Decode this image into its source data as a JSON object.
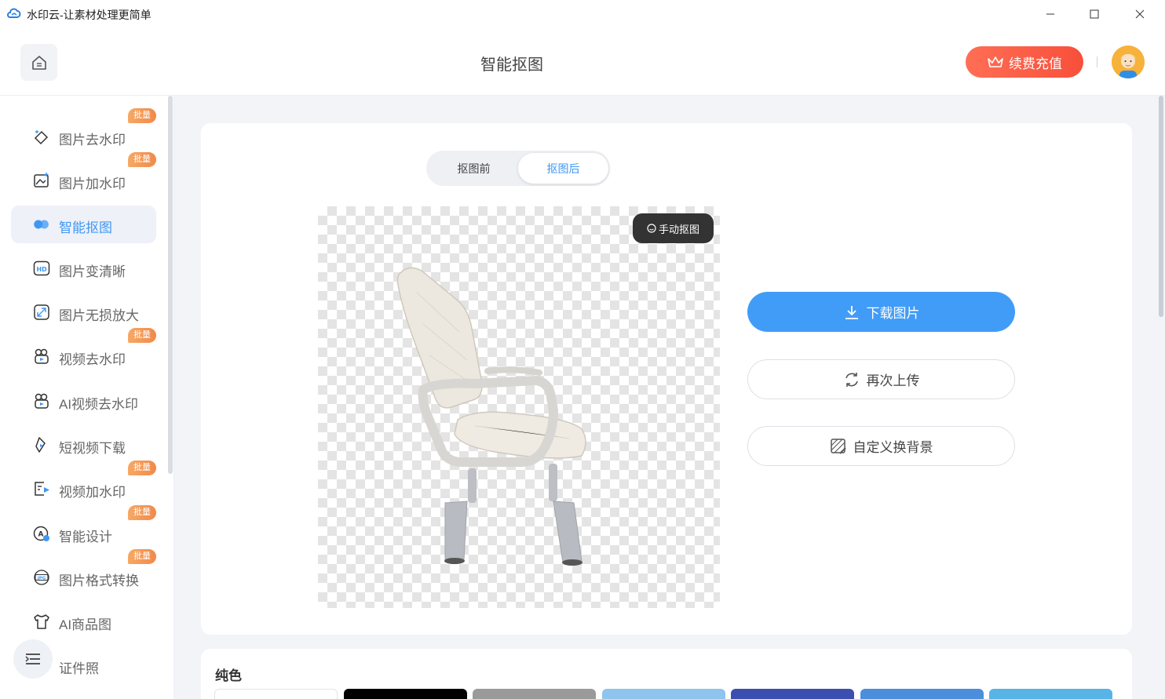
{
  "window": {
    "title": "水印云-让素材处理更简单"
  },
  "header": {
    "page_title": "智能抠图",
    "renew_label": "续费充值"
  },
  "sidebar": {
    "items": [
      {
        "label": "图片去水印",
        "badge": "批量",
        "icon": "image-remove-watermark-icon"
      },
      {
        "label": "图片加水印",
        "badge": "批量",
        "icon": "image-add-watermark-icon"
      },
      {
        "label": "智能抠图",
        "badge": "",
        "icon": "smart-cutout-icon",
        "active": true
      },
      {
        "label": "图片变清晰",
        "badge": "",
        "icon": "hd-icon"
      },
      {
        "label": "图片无损放大",
        "badge": "",
        "icon": "enlarge-icon"
      },
      {
        "label": "视频去水印",
        "badge": "批量",
        "icon": "video-remove-watermark-icon"
      },
      {
        "label": "AI视频去水印",
        "badge": "",
        "icon": "ai-video-remove-watermark-icon"
      },
      {
        "label": "短视频下载",
        "badge": "",
        "icon": "short-video-download-icon"
      },
      {
        "label": "视频加水印",
        "badge": "批量",
        "icon": "video-add-watermark-icon"
      },
      {
        "label": "智能设计",
        "badge": "批量",
        "icon": "smart-design-icon"
      },
      {
        "label": "图片格式转换",
        "badge": "批量",
        "icon": "jpg-convert-icon"
      },
      {
        "label": "AI商品图",
        "badge": "",
        "icon": "ai-product-image-icon"
      },
      {
        "label": "证件照",
        "badge": "",
        "icon": "id-photo-icon"
      }
    ]
  },
  "editor": {
    "tab_before": "抠图前",
    "tab_after": "抠图后",
    "manual_cutout": "手动抠图",
    "download": "下载图片",
    "reupload": "再次上传",
    "custom_background": "自定义换背景"
  },
  "background_panel": {
    "title": "纯色",
    "swatches": [
      "#ffffff",
      "#000000",
      "#9a9a9a",
      "#8fc4ef",
      "#3a4fb0",
      "#4a8fdc",
      "#56b4e6"
    ]
  },
  "colors": {
    "accent": "#3f97f5",
    "renew_gradient_start": "#ff6e55",
    "renew_gradient_end": "#f84f3a",
    "badge": "#f08a4a"
  }
}
